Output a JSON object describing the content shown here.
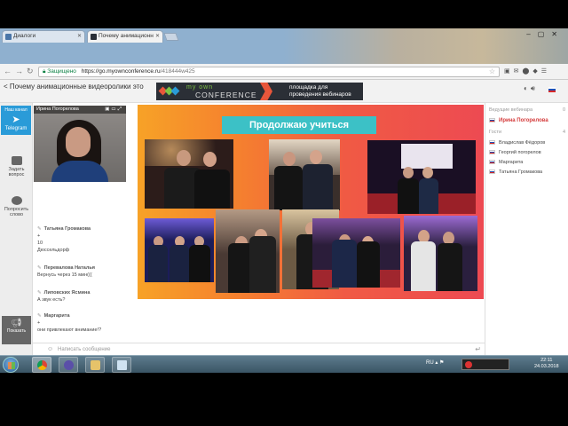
{
  "browser": {
    "tabs": [
      {
        "label": "Диалоги",
        "active": false
      },
      {
        "label": "Почему анимационн",
        "active": true
      }
    ],
    "secure_label": "Защищено",
    "url_host": "https://go.myownconference.ru",
    "url_path": "/418444w425"
  },
  "app": {
    "title": "< Почему анимационные видеоролики это",
    "banner_logo_top": "my own",
    "banner_logo_bottom": "CONFERENCE",
    "banner_tagline": "площадка для проведения вебинаров"
  },
  "rail": {
    "telegram_top": "Наш канал",
    "telegram_label": "Telegram",
    "ask_label": "Задать вопрос",
    "speak_label": "Попросить слово",
    "present_label": "Показать"
  },
  "video": {
    "name": "Ирина Погорелова"
  },
  "chat": {
    "messages": [
      {
        "author": "Татьяна Громакова",
        "lines": [
          "+",
          "10",
          "Дюссельдорф"
        ]
      },
      {
        "author": "Перевалова Наталья",
        "lines": [
          "Вернусь через 15 мин((("
        ]
      },
      {
        "author": "Липовских Ясмина",
        "lines": [
          "А звук есть?"
        ]
      },
      {
        "author": "Маргарита",
        "lines": [
          "+",
          "они привлекают внимание!?"
        ]
      }
    ],
    "input_placeholder": "Написать сообщение"
  },
  "slide": {
    "title": "Продолжаю учиться"
  },
  "panel": {
    "host_header": "Ведущие вебинара",
    "host_count": "0",
    "host_name": "Ирина Погорелова",
    "guests_title": "Гости",
    "guests_count": "4",
    "guests": [
      "Владислав Фёдоров",
      "Георгий погорелов",
      "Маргарита",
      "Татьяна Громакова"
    ]
  },
  "taskbar": {
    "lang": "RU",
    "time": "22:11",
    "date": "24.03.2018"
  },
  "colors": {
    "accent": "#2a9bd8",
    "slide_title_bg": "#3cc1c6",
    "host_name": "#d43a3a"
  }
}
